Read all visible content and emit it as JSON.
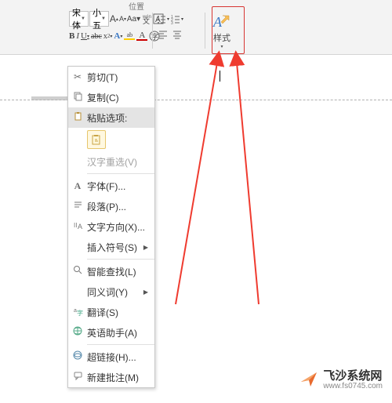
{
  "ribbon": {
    "tabs": {
      "t1": "",
      "t2": "位置"
    },
    "font_name": "宋体",
    "font_size": "小五",
    "grow_tip": "A",
    "shrink_tip": "A",
    "bold": "B",
    "italic": "I",
    "underline": "U",
    "strike": "abc",
    "super": "x²",
    "sub": "A",
    "fontcolor": "A",
    "highlight": "ab",
    "style_label": "样式"
  },
  "menu": {
    "cut": "剪切(T)",
    "copy": "复制(C)",
    "paste_header": "粘贴选项:",
    "reconv": "汉字重选(V)",
    "font": "字体(F)...",
    "para": "段落(P)...",
    "textdir": "文字方向(X)...",
    "symbol": "插入符号(S)",
    "smart": "智能查找(L)",
    "synonym": "同义词(Y)",
    "translate": "翻译(S)",
    "en_assist": "英语助手(A)",
    "hyperlink": "超链接(H)...",
    "comment": "新建批注(M)"
  },
  "watermark": {
    "brand": "飞沙系统网",
    "url": "www.fs0745.com"
  }
}
